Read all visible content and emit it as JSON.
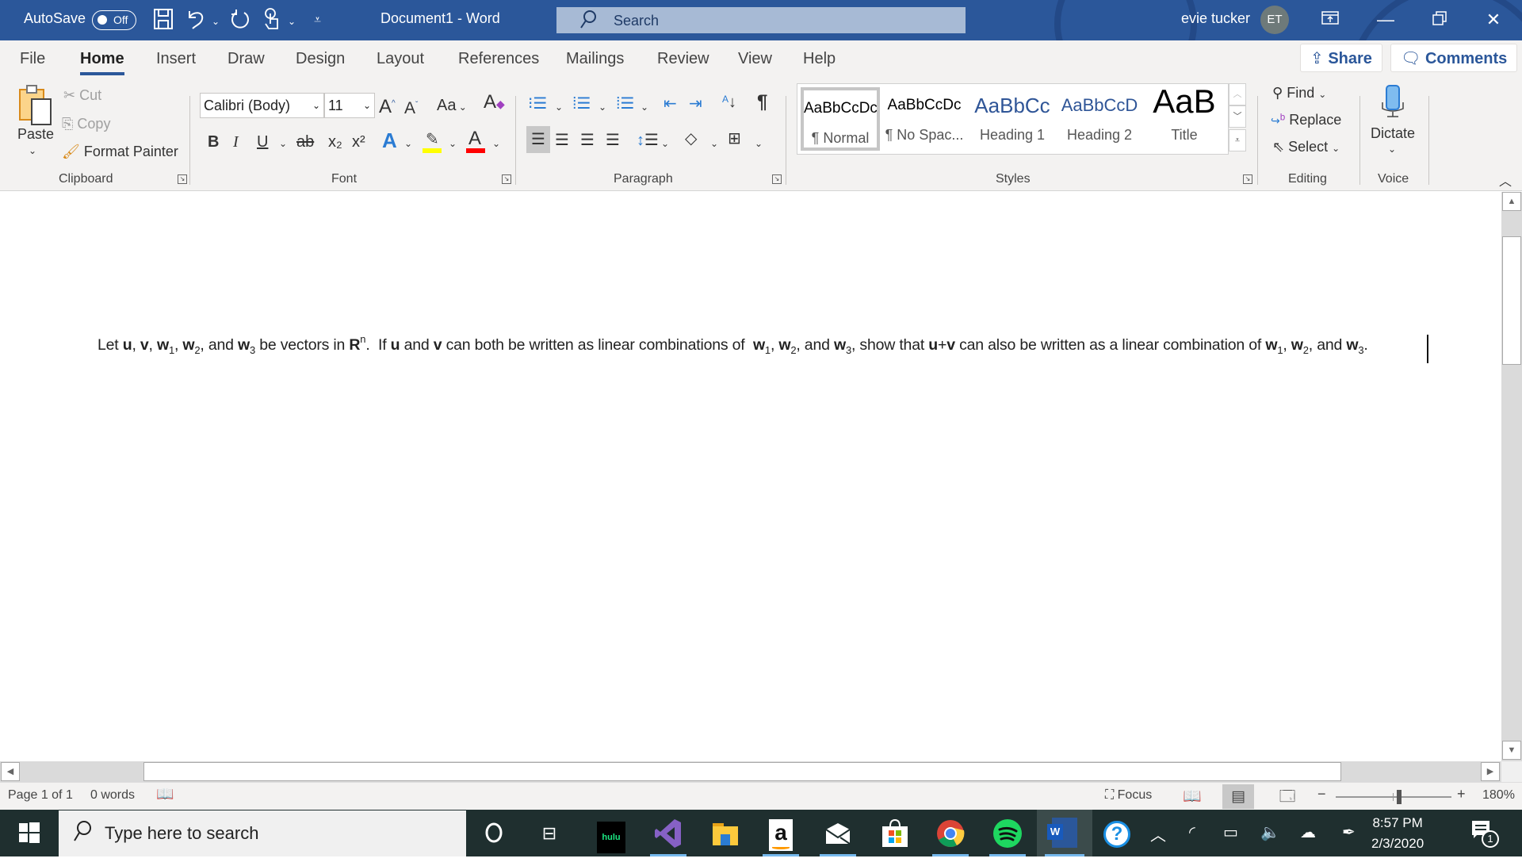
{
  "titlebar": {
    "autosave_label": "AutoSave",
    "autosave_state": "Off",
    "document_title": "Document1  -  Word",
    "search_placeholder": "Search",
    "user_name": "evie tucker",
    "user_initials": "ET",
    "quick_access_icons": [
      "save-icon",
      "undo-icon",
      "redo-icon",
      "touch-mode-icon",
      "customize-icon"
    ],
    "window_buttons": [
      "ribbon-display-options",
      "minimize",
      "restore",
      "close"
    ]
  },
  "tabs": [
    {
      "label": "File",
      "active": false
    },
    {
      "label": "Home",
      "active": true
    },
    {
      "label": "Insert",
      "active": false
    },
    {
      "label": "Draw",
      "active": false
    },
    {
      "label": "Design",
      "active": false
    },
    {
      "label": "Layout",
      "active": false
    },
    {
      "label": "References",
      "active": false
    },
    {
      "label": "Mailings",
      "active": false
    },
    {
      "label": "Review",
      "active": false
    },
    {
      "label": "View",
      "active": false
    },
    {
      "label": "Help",
      "active": false
    }
  ],
  "share_label": "Share",
  "comments_label": "Comments",
  "ribbon": {
    "clipboard": {
      "label": "Clipboard",
      "paste": "Paste",
      "cut": "Cut",
      "copy": "Copy",
      "format_painter": "Format Painter"
    },
    "font": {
      "label": "Font",
      "font_name": "Calibri (Body)",
      "font_size": "11",
      "change_case": "Aa",
      "bold": "B",
      "italic": "I",
      "underline": "U",
      "strikethrough": "ab",
      "subscript": "x₂",
      "superscript": "x²",
      "highlight_color": "#ffff00",
      "font_color": "#ff0000"
    },
    "paragraph": {
      "label": "Paragraph",
      "show_marks": "¶",
      "active_alignment": "left"
    },
    "styles": {
      "label": "Styles",
      "items": [
        {
          "sample": "AaBbCcDc",
          "name": "¶ Normal",
          "selected": true,
          "color": "#000000"
        },
        {
          "sample": "AaBbCcDc",
          "name": "¶ No Spac...",
          "selected": false,
          "color": "#000000"
        },
        {
          "sample": "AaBbCc",
          "name": "Heading 1",
          "selected": false,
          "color": "#2f5597"
        },
        {
          "sample": "AaBbCcD",
          "name": "Heading 2",
          "selected": false,
          "color": "#2f5597"
        },
        {
          "sample": "AaB",
          "name": "Title",
          "selected": false,
          "color": "#000000"
        }
      ]
    },
    "editing": {
      "label": "Editing",
      "find": "Find",
      "replace": "Replace",
      "select": "Select"
    },
    "voice": {
      "label": "Voice",
      "dictate": "Dictate"
    }
  },
  "document": {
    "segments": [
      {
        "t": "Let "
      },
      {
        "b": "u"
      },
      {
        "t": ", "
      },
      {
        "b": "v"
      },
      {
        "t": ", "
      },
      {
        "b": "w"
      },
      {
        "sub": "1"
      },
      {
        "t": ", "
      },
      {
        "b": "w"
      },
      {
        "sub": "2"
      },
      {
        "t": ", and "
      },
      {
        "b": "w"
      },
      {
        "sub": "3"
      },
      {
        "t": " be vectors in "
      },
      {
        "b": "R"
      },
      {
        "sup": "n"
      },
      {
        "t": ".  If "
      },
      {
        "b": "u"
      },
      {
        "t": " and "
      },
      {
        "b": "v"
      },
      {
        "t": " can both be written as linear combinations of  "
      },
      {
        "b": "w"
      },
      {
        "sub": "1"
      },
      {
        "t": ", "
      },
      {
        "b": "w"
      },
      {
        "sub": "2"
      },
      {
        "t": ", and "
      },
      {
        "b": "w"
      },
      {
        "sub": "3"
      },
      {
        "t": ", show that "
      },
      {
        "b": "u"
      },
      {
        "t": "+"
      },
      {
        "b": "v"
      },
      {
        "t": " can also be written as a linear combination of "
      },
      {
        "b": "w"
      },
      {
        "sub": "1"
      },
      {
        "t": ", "
      },
      {
        "b": "w"
      },
      {
        "sub": "2"
      },
      {
        "t": ", and "
      },
      {
        "b": "w"
      },
      {
        "sub": "3"
      },
      {
        "t": "."
      }
    ]
  },
  "statusbar": {
    "page": "Page 1 of 1",
    "words": "0 words",
    "focus": "Focus",
    "zoom_level": "180%",
    "zoom_fraction": 0.55
  },
  "taskbar": {
    "search_placeholder": "Type here to search",
    "apps": [
      "cortana",
      "task-view",
      "hulu",
      "visual-studio",
      "file-explorer",
      "amazon",
      "mail",
      "microsoft-store",
      "chrome",
      "spotify",
      "word",
      "help"
    ],
    "hulu_label": "hulu",
    "amazon_label": "a",
    "word_label": "W",
    "time": "8:57 PM",
    "date": "2/3/2020",
    "notification_count": "1"
  }
}
